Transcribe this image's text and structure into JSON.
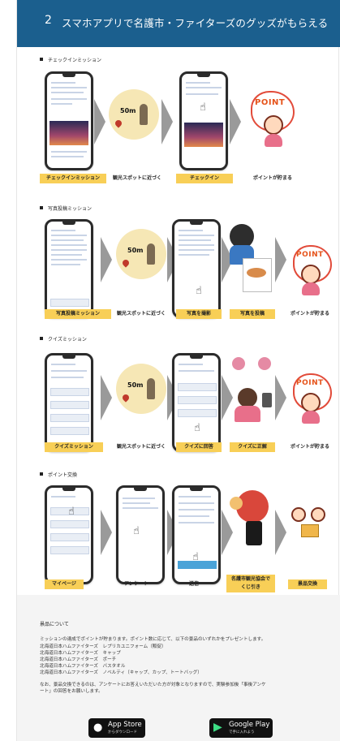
{
  "header": {
    "number": "2",
    "title": "スマホアプリで名護市・ファイターズのグッズがもらえる"
  },
  "sections": [
    {
      "title": "チェックインミッション",
      "steps": [
        "チェックインミッション",
        "観光スポットに近づく",
        "チェックイン",
        "ポイントが貯まる"
      ]
    },
    {
      "title": "写真投稿ミッション",
      "steps": [
        "写真投稿ミッション",
        "観光スポットに近づく",
        "写真を撮影",
        "写真を投稿",
        "ポイントが貯まる"
      ]
    },
    {
      "title": "クイズミッション",
      "steps": [
        "クイズミッション",
        "観光スポットに近づく",
        "クイズに回答",
        "クイズに正解",
        "ポイントが貯まる"
      ]
    },
    {
      "title": "ポイント交換",
      "steps": [
        "マイページ",
        "アンケート",
        "送信",
        "名護市観光協会で\nくじ引き",
        "景品交換"
      ]
    }
  ],
  "illustrations": {
    "distance": "50m",
    "point": "POINT"
  },
  "prizes": {
    "heading": "景品について",
    "intro": "ミッションの達成でポイントが貯まります。ポイント数に応じて、以下の景品のいずれかをプレゼントします。",
    "items": [
      "北海道日本ハムファイターズ　レプリカユニフォーム（販促）",
      "北海道日本ハムファイターズ　キャップ",
      "北海道日本ハムファイターズ　ポーチ",
      "北海道日本ハムファイターズ　バスタオル",
      "北海道日本ハムファイターズ　ノベルティ（キャップ、カップ、トートバッグ）"
    ],
    "note_line1": "なお、景品交換できるのは、アンケートにお答えいただいた方が対象となりますので、実験参加後「事後アンケ",
    "note_line2": "ート」の回答をお願いします。"
  },
  "stores": {
    "appstore": {
      "small": "からダウンロード",
      "big": "App Store"
    },
    "googleplay": {
      "small": "で手に入れよう",
      "big": "Google Play"
    }
  }
}
